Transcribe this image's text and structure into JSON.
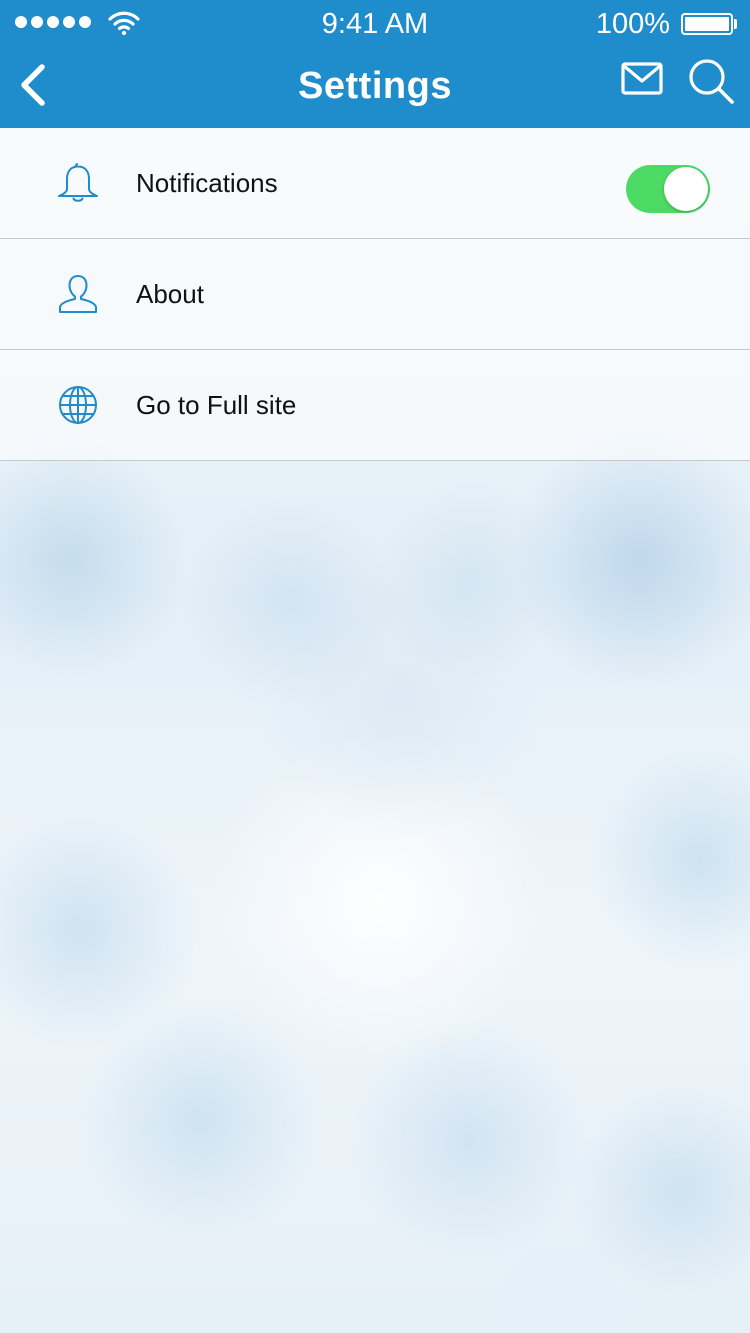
{
  "status_bar": {
    "time": "9:41 AM",
    "battery_percent": "100%",
    "signal_bars": 5
  },
  "nav": {
    "title": "Settings",
    "back_icon": "chevron-left-icon",
    "mail_icon": "mail-icon",
    "search_icon": "search-icon"
  },
  "settings": [
    {
      "label": "Notifications",
      "icon": "bell-icon",
      "toggle": true
    },
    {
      "label": "About",
      "icon": "user-icon"
    },
    {
      "label": "Go to Full site",
      "icon": "globe-icon"
    }
  ],
  "colors": {
    "header": "#1f8ccb",
    "icon": "#1f8ccb",
    "toggle_on": "#4cd964"
  }
}
